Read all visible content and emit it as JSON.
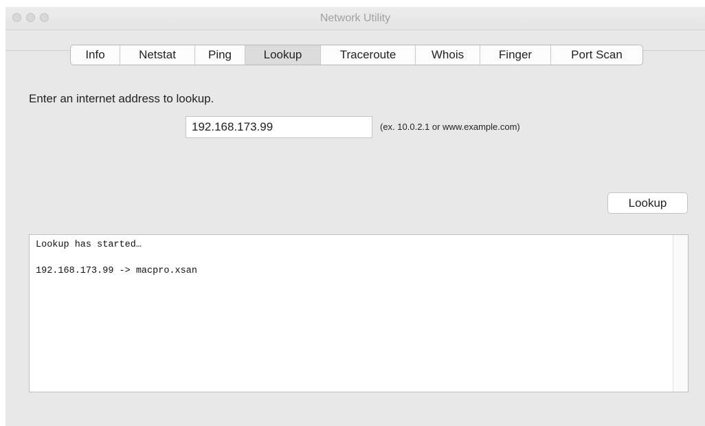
{
  "window": {
    "title": "Network Utility"
  },
  "tabs": [
    {
      "label": "Info"
    },
    {
      "label": "Netstat"
    },
    {
      "label": "Ping"
    },
    {
      "label": "Lookup",
      "selected": true
    },
    {
      "label": "Traceroute"
    },
    {
      "label": "Whois"
    },
    {
      "label": "Finger"
    },
    {
      "label": "Port Scan"
    }
  ],
  "lookup": {
    "prompt": "Enter an internet address to lookup.",
    "address_value": "192.168.173.99",
    "hint": "(ex. 10.0.2.1 or www.example.com)",
    "button_label": "Lookup"
  },
  "output": {
    "lines": [
      "Lookup has started…",
      "",
      "192.168.173.99 -> macpro.xsan"
    ]
  }
}
